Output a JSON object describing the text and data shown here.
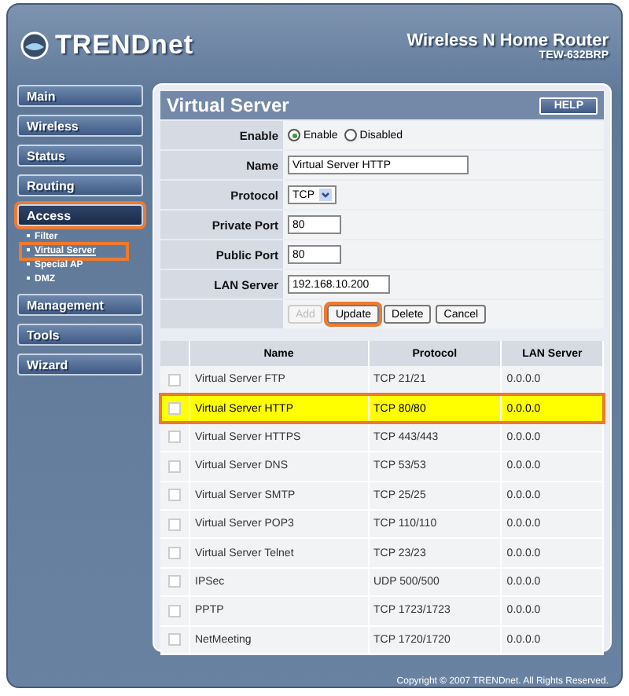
{
  "header": {
    "brand": "TRENDnet",
    "product": "Wireless N Home Router",
    "model": "TEW-632BRP"
  },
  "sidebar": {
    "items": [
      {
        "label": "Main",
        "selected": false,
        "highlighted": false
      },
      {
        "label": "Wireless",
        "selected": false,
        "highlighted": false
      },
      {
        "label": "Status",
        "selected": false,
        "highlighted": false
      },
      {
        "label": "Routing",
        "selected": false,
        "highlighted": false
      },
      {
        "label": "Access",
        "selected": true,
        "highlighted": true,
        "children": [
          {
            "label": "Filter",
            "selected": false,
            "highlighted": false
          },
          {
            "label": "Virtual Server",
            "selected": true,
            "highlighted": true
          },
          {
            "label": "Special AP",
            "selected": false,
            "highlighted": false
          },
          {
            "label": "DMZ",
            "selected": false,
            "highlighted": false
          }
        ]
      },
      {
        "label": "Management",
        "selected": false,
        "highlighted": false
      },
      {
        "label": "Tools",
        "selected": false,
        "highlighted": false
      },
      {
        "label": "Wizard",
        "selected": false,
        "highlighted": false
      }
    ]
  },
  "panel": {
    "title": "Virtual Server",
    "help": "HELP",
    "form": [
      {
        "kind": "radio",
        "label": "Enable",
        "options": [
          {
            "label": "Enable",
            "selected": true
          },
          {
            "label": "Disabled",
            "selected": false
          }
        ]
      },
      {
        "kind": "text",
        "label": "Name",
        "value": "Virtual Server HTTP"
      },
      {
        "kind": "select",
        "label": "Protocol",
        "value": "TCP"
      },
      {
        "kind": "text",
        "label": "Private Port",
        "value": "80"
      },
      {
        "kind": "text",
        "label": "Public Port",
        "value": "80"
      },
      {
        "kind": "text",
        "label": "LAN Server",
        "value": "192.168.10.200"
      }
    ],
    "buttons": [
      {
        "label": "Add",
        "disabled": true,
        "highlighted": false
      },
      {
        "label": "Update",
        "disabled": false,
        "highlighted": true
      },
      {
        "label": "Delete",
        "disabled": false,
        "highlighted": false
      },
      {
        "label": "Cancel",
        "disabled": false,
        "highlighted": false
      }
    ],
    "table": {
      "columns": [
        "Name",
        "Protocol",
        "LAN Server"
      ],
      "rows": [
        {
          "name": "Virtual Server FTP",
          "protocol": "TCP 21/21",
          "lan_server": "0.0.0.0",
          "checked": false,
          "selected": false
        },
        {
          "name": "Virtual Server HTTP",
          "protocol": "TCP 80/80",
          "lan_server": "0.0.0.0",
          "checked": false,
          "selected": true
        },
        {
          "name": "Virtual Server HTTPS",
          "protocol": "TCP 443/443",
          "lan_server": "0.0.0.0",
          "checked": false,
          "selected": false
        },
        {
          "name": "Virtual Server DNS",
          "protocol": "TCP 53/53",
          "lan_server": "0.0.0.0",
          "checked": false,
          "selected": false
        },
        {
          "name": "Virtual Server SMTP",
          "protocol": "TCP 25/25",
          "lan_server": "0.0.0.0",
          "checked": false,
          "selected": false
        },
        {
          "name": "Virtual Server POP3",
          "protocol": "TCP 110/110",
          "lan_server": "0.0.0.0",
          "checked": false,
          "selected": false
        },
        {
          "name": "Virtual Server Telnet",
          "protocol": "TCP 23/23",
          "lan_server": "0.0.0.0",
          "checked": false,
          "selected": false
        },
        {
          "name": "IPSec",
          "protocol": "UDP 500/500",
          "lan_server": "0.0.0.0",
          "checked": false,
          "selected": false
        },
        {
          "name": "PPTP",
          "protocol": "TCP 1723/1723",
          "lan_server": "0.0.0.0",
          "checked": false,
          "selected": false
        },
        {
          "name": "NetMeeting",
          "protocol": "TCP 1720/1720",
          "lan_server": "0.0.0.0",
          "checked": false,
          "selected": false
        }
      ]
    }
  },
  "footer": {
    "copyright": "Copyright © 2007 TRENDnet. All Rights Reserved."
  }
}
